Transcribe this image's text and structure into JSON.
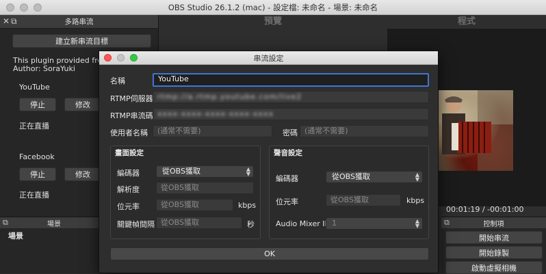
{
  "window": {
    "title": "OBS Studio 26.1.2 (mac) - 設定檔: 未命名 - 場景: 未命名"
  },
  "multistream": {
    "dock_title": "多路串流",
    "new_target_button": "建立新串流目標",
    "plugin_note": "This plugin provided free of",
    "author": "Author: SoraYuki",
    "targets": [
      {
        "name": "YouTube",
        "stop_label": "停止",
        "edit_label": "修改",
        "status": "正在直播"
      },
      {
        "name": "Facebook",
        "stop_label": "停止",
        "edit_label": "修改",
        "status": "正在直播"
      }
    ]
  },
  "preview": {
    "header": "預覽"
  },
  "program": {
    "header": "程式",
    "timecode_current": "00:01:19",
    "timecode_total": "-00:01:00"
  },
  "scenes": {
    "dock_title": "場景",
    "header": "場景"
  },
  "controls": {
    "dock_title": "控制項",
    "start_stream": "開始串流",
    "start_record": "開始錄製",
    "start_virtualcam": "啟動虛擬相機"
  },
  "dialog": {
    "title": "串流設定",
    "name_label": "名稱",
    "name_value": "YouTube",
    "rtmp_server_label": "RTMP伺服器",
    "rtmp_server_value": "rtmp://a.rtmp.youtube.com/live2",
    "rtmp_key_label": "RTMP串流碼",
    "rtmp_key_value": "xxxx-xxxx-xxxx-xxxx-xxxx",
    "username_label": "使用者名稱",
    "username_placeholder": "(通常不需要)",
    "password_label": "密碼",
    "password_placeholder": "(通常不需要)",
    "video": {
      "title": "畫面設定",
      "encoder_label": "編碼器",
      "encoder_value": "從OBS獲取",
      "resolution_label": "解析度",
      "resolution_placeholder": "從OBS獲取",
      "bitrate_label": "位元率",
      "bitrate_placeholder": "從OBS獲取",
      "bitrate_unit": "kbps",
      "keyframe_label": "關鍵幀間隔",
      "keyframe_placeholder": "從OBS獲取",
      "keyframe_unit": "秒"
    },
    "audio": {
      "title": "聲音設定",
      "encoder_label": "編碼器",
      "encoder_value": "從OBS獲取",
      "bitrate_label": "位元率",
      "bitrate_placeholder": "從OBS獲取",
      "bitrate_unit": "kbps",
      "mixer_label": "Audio Mixer ID",
      "mixer_value": "1"
    },
    "ok_button": "OK"
  },
  "colors": {
    "focus_ring": "#3a78d6",
    "close": "#fc5753",
    "zoom": "#34c84a"
  }
}
